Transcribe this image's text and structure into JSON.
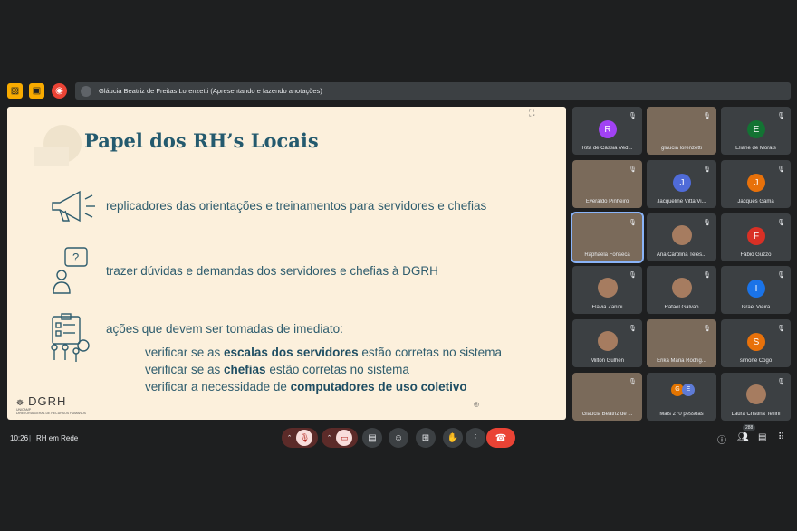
{
  "presenter": {
    "label": "Gláucia Beatriz de Freitas Lorenzetti (Apresentando e fazendo anotações)"
  },
  "slide": {
    "title": "Papel dos RH’s Locais",
    "item1": "replicadores das orientações e treinamentos para servidores e chefias",
    "item2": "trazer dúvidas e demandas dos servidores e chefias à DGRH",
    "item3": "ações que devem ser tomadas de imediato:",
    "sub1_a": "verificar se as ",
    "sub1_b": "escalas dos servidores",
    "sub1_c": " estão corretas no sistema",
    "sub2_a": "verificar se as ",
    "sub2_b": "chefias",
    "sub2_c": " estão corretas no sistema",
    "sub3_a": "verificar a necessidade de ",
    "sub3_b": "computadores de uso coletivo",
    "logo": "DGRH",
    "logo_sub": "DIRETORIA GERAL DE RECURSOS HUMANOS",
    "org": "UNICAMP"
  },
  "participants": [
    {
      "name": "Rita de Cássia Ved...",
      "initial": "R",
      "color": "#a142f4"
    },
    {
      "name": "gláucia lorenzetti",
      "initial": "",
      "color": "#7a6a5a"
    },
    {
      "name": "Eliane de Morais",
      "initial": "E",
      "color": "#137333"
    },
    {
      "name": "Everaldo Pinheiro",
      "initial": "",
      "color": "#7a6a5a"
    },
    {
      "name": "Jacqueline Vitta Vi...",
      "initial": "J",
      "color": "#4f6bd8"
    },
    {
      "name": "Jacques Gama",
      "initial": "J",
      "color": "#e8710a"
    },
    {
      "name": "Raphaela Fonseca",
      "initial": "",
      "color": "#7a6a5a"
    },
    {
      "name": "Ana Carolina Teles...",
      "initial": "",
      "color": "#3c4043"
    },
    {
      "name": "Fábio Guzzo",
      "initial": "F",
      "color": "#d93025"
    },
    {
      "name": "Flavia Zanini",
      "initial": "",
      "color": "#3c4043"
    },
    {
      "name": "Rafael Galvão",
      "initial": "",
      "color": "#3c4043"
    },
    {
      "name": "Israel Vieira",
      "initial": "I",
      "color": "#1a73e8"
    },
    {
      "name": "Milton Gulhen",
      "initial": "",
      "color": "#3c4043"
    },
    {
      "name": "Erika Maria Rodrig...",
      "initial": "",
      "color": "#7a6a5a"
    },
    {
      "name": "simone Cogo",
      "initial": "S",
      "color": "#e8710a"
    },
    {
      "name": "Gláucia Beatriz de ...",
      "initial": "",
      "color": "#8a6a4a"
    },
    {
      "name": "Mais 270 pessoas",
      "initial": "",
      "color": "#3c4043"
    },
    {
      "name": "Laura Cristina Tellini",
      "initial": "",
      "color": "#3c4043"
    }
  ],
  "bottom": {
    "time": "10:26",
    "separator": "|",
    "meeting": "RH em Rede",
    "people_count": "288"
  },
  "colors": {
    "slide_bg": "#fcf0dc",
    "title": "#245a6e",
    "end_call": "#ea4335",
    "mic_off": "#f9dedc"
  }
}
